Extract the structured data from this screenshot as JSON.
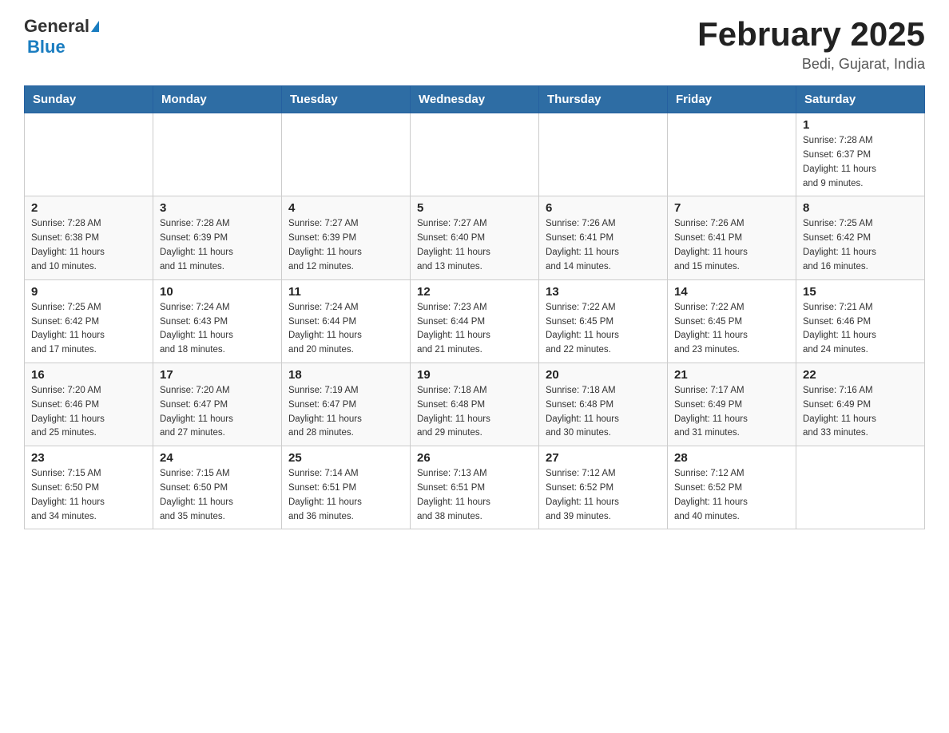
{
  "header": {
    "logo_general": "General",
    "logo_blue": "Blue",
    "title": "February 2025",
    "subtitle": "Bedi, Gujarat, India"
  },
  "days_of_week": [
    "Sunday",
    "Monday",
    "Tuesday",
    "Wednesday",
    "Thursday",
    "Friday",
    "Saturday"
  ],
  "weeks": [
    [
      {
        "day": "",
        "info": ""
      },
      {
        "day": "",
        "info": ""
      },
      {
        "day": "",
        "info": ""
      },
      {
        "day": "",
        "info": ""
      },
      {
        "day": "",
        "info": ""
      },
      {
        "day": "",
        "info": ""
      },
      {
        "day": "1",
        "info": "Sunrise: 7:28 AM\nSunset: 6:37 PM\nDaylight: 11 hours\nand 9 minutes."
      }
    ],
    [
      {
        "day": "2",
        "info": "Sunrise: 7:28 AM\nSunset: 6:38 PM\nDaylight: 11 hours\nand 10 minutes."
      },
      {
        "day": "3",
        "info": "Sunrise: 7:28 AM\nSunset: 6:39 PM\nDaylight: 11 hours\nand 11 minutes."
      },
      {
        "day": "4",
        "info": "Sunrise: 7:27 AM\nSunset: 6:39 PM\nDaylight: 11 hours\nand 12 minutes."
      },
      {
        "day": "5",
        "info": "Sunrise: 7:27 AM\nSunset: 6:40 PM\nDaylight: 11 hours\nand 13 minutes."
      },
      {
        "day": "6",
        "info": "Sunrise: 7:26 AM\nSunset: 6:41 PM\nDaylight: 11 hours\nand 14 minutes."
      },
      {
        "day": "7",
        "info": "Sunrise: 7:26 AM\nSunset: 6:41 PM\nDaylight: 11 hours\nand 15 minutes."
      },
      {
        "day": "8",
        "info": "Sunrise: 7:25 AM\nSunset: 6:42 PM\nDaylight: 11 hours\nand 16 minutes."
      }
    ],
    [
      {
        "day": "9",
        "info": "Sunrise: 7:25 AM\nSunset: 6:42 PM\nDaylight: 11 hours\nand 17 minutes."
      },
      {
        "day": "10",
        "info": "Sunrise: 7:24 AM\nSunset: 6:43 PM\nDaylight: 11 hours\nand 18 minutes."
      },
      {
        "day": "11",
        "info": "Sunrise: 7:24 AM\nSunset: 6:44 PM\nDaylight: 11 hours\nand 20 minutes."
      },
      {
        "day": "12",
        "info": "Sunrise: 7:23 AM\nSunset: 6:44 PM\nDaylight: 11 hours\nand 21 minutes."
      },
      {
        "day": "13",
        "info": "Sunrise: 7:22 AM\nSunset: 6:45 PM\nDaylight: 11 hours\nand 22 minutes."
      },
      {
        "day": "14",
        "info": "Sunrise: 7:22 AM\nSunset: 6:45 PM\nDaylight: 11 hours\nand 23 minutes."
      },
      {
        "day": "15",
        "info": "Sunrise: 7:21 AM\nSunset: 6:46 PM\nDaylight: 11 hours\nand 24 minutes."
      }
    ],
    [
      {
        "day": "16",
        "info": "Sunrise: 7:20 AM\nSunset: 6:46 PM\nDaylight: 11 hours\nand 25 minutes."
      },
      {
        "day": "17",
        "info": "Sunrise: 7:20 AM\nSunset: 6:47 PM\nDaylight: 11 hours\nand 27 minutes."
      },
      {
        "day": "18",
        "info": "Sunrise: 7:19 AM\nSunset: 6:47 PM\nDaylight: 11 hours\nand 28 minutes."
      },
      {
        "day": "19",
        "info": "Sunrise: 7:18 AM\nSunset: 6:48 PM\nDaylight: 11 hours\nand 29 minutes."
      },
      {
        "day": "20",
        "info": "Sunrise: 7:18 AM\nSunset: 6:48 PM\nDaylight: 11 hours\nand 30 minutes."
      },
      {
        "day": "21",
        "info": "Sunrise: 7:17 AM\nSunset: 6:49 PM\nDaylight: 11 hours\nand 31 minutes."
      },
      {
        "day": "22",
        "info": "Sunrise: 7:16 AM\nSunset: 6:49 PM\nDaylight: 11 hours\nand 33 minutes."
      }
    ],
    [
      {
        "day": "23",
        "info": "Sunrise: 7:15 AM\nSunset: 6:50 PM\nDaylight: 11 hours\nand 34 minutes."
      },
      {
        "day": "24",
        "info": "Sunrise: 7:15 AM\nSunset: 6:50 PM\nDaylight: 11 hours\nand 35 minutes."
      },
      {
        "day": "25",
        "info": "Sunrise: 7:14 AM\nSunset: 6:51 PM\nDaylight: 11 hours\nand 36 minutes."
      },
      {
        "day": "26",
        "info": "Sunrise: 7:13 AM\nSunset: 6:51 PM\nDaylight: 11 hours\nand 38 minutes."
      },
      {
        "day": "27",
        "info": "Sunrise: 7:12 AM\nSunset: 6:52 PM\nDaylight: 11 hours\nand 39 minutes."
      },
      {
        "day": "28",
        "info": "Sunrise: 7:12 AM\nSunset: 6:52 PM\nDaylight: 11 hours\nand 40 minutes."
      },
      {
        "day": "",
        "info": ""
      }
    ]
  ]
}
